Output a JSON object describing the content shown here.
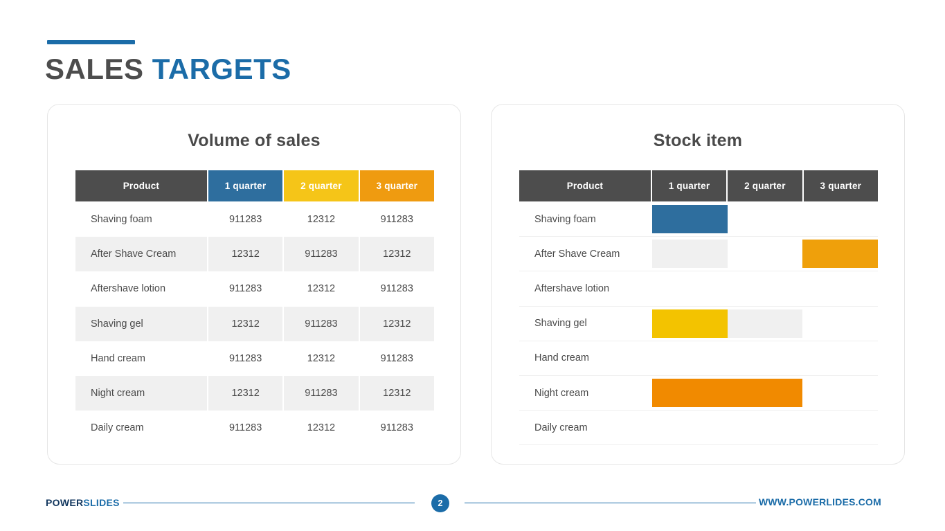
{
  "header": {
    "title_part1": "SALES ",
    "title_part2": "TARGETS",
    "accent_color": "#1B6CA8",
    "title_dark_color": "#4D4D4D"
  },
  "cards": {
    "left": {
      "title": "Volume of sales",
      "columns": [
        "Product",
        "1 quarter",
        "2 quarter",
        "3 quarter"
      ],
      "header_colors": [
        "#4D4D4D",
        "#2E6E9E",
        "#F5C518",
        "#EF9B10"
      ],
      "rows": [
        {
          "product": "Shaving foam",
          "q1": "911283",
          "q2": "12312",
          "q3": "911283",
          "shaded": false
        },
        {
          "product": "After Shave Cream",
          "q1": "12312",
          "q2": "911283",
          "q3": "12312",
          "shaded": true
        },
        {
          "product": "Aftershave lotion",
          "q1": "911283",
          "q2": "12312",
          "q3": "911283",
          "shaded": false
        },
        {
          "product": "Shaving gel",
          "q1": "12312",
          "q2": "911283",
          "q3": "12312",
          "shaded": true
        },
        {
          "product": "Hand cream",
          "q1": "911283",
          "q2": "12312",
          "q3": "911283",
          "shaded": false
        },
        {
          "product": "Night cream",
          "q1": "12312",
          "q2": "911283",
          "q3": "12312",
          "shaded": true
        },
        {
          "product": "Daily cream",
          "q1": "911283",
          "q2": "12312",
          "q3": "911283",
          "shaded": false
        }
      ]
    },
    "right": {
      "title": "Stock item",
      "columns": [
        "Product",
        "1 quarter",
        "2 quarter",
        "3 quarter"
      ],
      "header_color": "#4D4D4D",
      "rows": [
        {
          "product": "Shaving foam",
          "q1": "blue",
          "q2": "none",
          "q3": "none"
        },
        {
          "product": "After Shave Cream",
          "q1": "grey",
          "q2": "none",
          "q3": "amber"
        },
        {
          "product": "Aftershave lotion",
          "q1": "none",
          "q2": "none",
          "q3": "none"
        },
        {
          "product": "Shaving gel",
          "q1": "yellow",
          "q2": "grey",
          "q3": "none"
        },
        {
          "product": "Hand cream",
          "q1": "none",
          "q2": "none",
          "q3": "none"
        },
        {
          "product": "Night cream",
          "q1": "orange",
          "q2": "orange",
          "q3": "none"
        },
        {
          "product": "Daily cream",
          "q1": "none",
          "q2": "none",
          "q3": "none"
        }
      ]
    }
  },
  "footer": {
    "brand_part1": "POWER",
    "brand_part2": "SLIDES",
    "page_number": "2",
    "site_url": "WWW.POWERLIDES.COM",
    "accent_color": "#1B6CA8"
  },
  "chart_data": {
    "type": "table",
    "title": "Sales Targets",
    "panels": [
      {
        "title": "Volume of sales",
        "type": "table",
        "columns": [
          "Product",
          "1 quarter",
          "2 quarter",
          "3 quarter"
        ],
        "rows": [
          [
            "Shaving foam",
            911283,
            12312,
            911283
          ],
          [
            "After Shave Cream",
            12312,
            911283,
            12312
          ],
          [
            "Aftershave lotion",
            911283,
            12312,
            911283
          ],
          [
            "Shaving gel",
            12312,
            911283,
            12312
          ],
          [
            "Hand cream",
            911283,
            12312,
            911283
          ],
          [
            "Night cream",
            12312,
            911283,
            12312
          ],
          [
            "Daily cream",
            911283,
            12312,
            911283
          ]
        ]
      },
      {
        "title": "Stock item",
        "type": "heatmap",
        "columns": [
          "Product",
          "1 quarter",
          "2 quarter",
          "3 quarter"
        ],
        "categories": [
          "Shaving foam",
          "After Shave Cream",
          "Aftershave lotion",
          "Shaving gel",
          "Hand cream",
          "Night cream",
          "Daily cream"
        ],
        "series": [
          {
            "name": "1 quarter",
            "values": [
              "blue",
              "grey",
              "none",
              "yellow",
              "none",
              "orange",
              "none"
            ]
          },
          {
            "name": "2 quarter",
            "values": [
              "none",
              "none",
              "none",
              "grey",
              "none",
              "orange",
              "none"
            ]
          },
          {
            "name": "3 quarter",
            "values": [
              "none",
              "amber",
              "none",
              "none",
              "none",
              "none",
              "none"
            ]
          }
        ],
        "legend_colors": {
          "blue": "#2E6E9E",
          "yellow": "#F3C300",
          "orange": "#F18A00",
          "amber": "#EFA00B",
          "grey": "#F0F0F0"
        }
      }
    ]
  }
}
